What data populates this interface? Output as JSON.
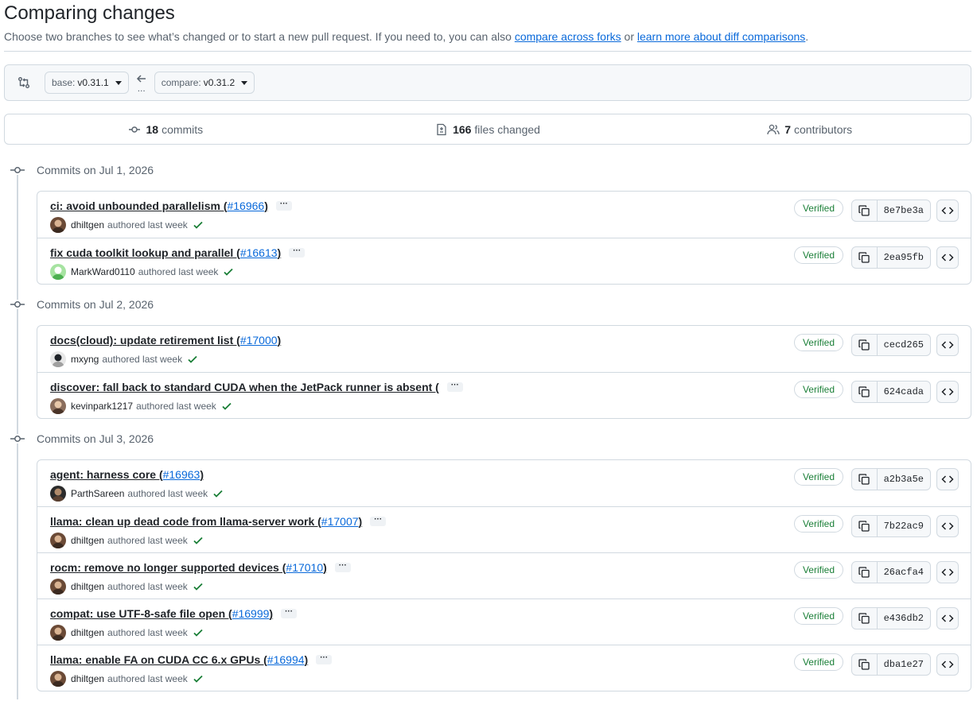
{
  "header": {
    "title": "Comparing changes",
    "subtitle_text": "Choose two branches to see what’s changed or to start a new pull request. If you need to, you can also",
    "link_forks": "compare across forks",
    "or_text": "or",
    "link_learn": "learn more about diff comparisons",
    "period": "."
  },
  "range": {
    "base_label": "base:",
    "base_value": "v0.31.1",
    "compare_label": "compare:",
    "compare_value": "v0.31.2",
    "arrow_dots": "..."
  },
  "stats": {
    "commits_count": "18",
    "commits_label": "commits",
    "files_count": "166",
    "files_label": "files changed",
    "contributors_count": "7",
    "contributors_label": "contributors"
  },
  "groups": [
    {
      "heading": "Commits on Jul 1, 2026",
      "commits": [
        {
          "message": "ci: avoid unbounded parallelism (",
          "pr": "#16966",
          "close": ")",
          "author": "dhiltgen",
          "authored": "authored last week",
          "verified": "Verified",
          "sha": "8e7be3a",
          "avatar": "dhiltgen",
          "has_ellipsis": true
        },
        {
          "message": "fix cuda toolkit lookup and parallel (",
          "pr": "#16613",
          "close": ")",
          "author": "MarkWard0110",
          "authored": "authored last week",
          "verified": "Verified",
          "sha": "2ea95fb",
          "avatar": "markward",
          "has_ellipsis": true
        }
      ]
    },
    {
      "heading": "Commits on Jul 2, 2026",
      "commits": [
        {
          "message": "docs(cloud): update retirement list (",
          "pr": "#17000",
          "close": ")",
          "author": "mxyng",
          "authored": "authored last week",
          "verified": "Verified",
          "sha": "cecd265",
          "avatar": "mxyng",
          "has_ellipsis": false
        },
        {
          "message": "discover: fall back to standard CUDA when the JetPack runner is absent (",
          "pr": "",
          "close": "",
          "author": "kevinpark1217",
          "authored": "authored last week",
          "verified": "Verified",
          "sha": "624cada",
          "avatar": "kevin",
          "has_ellipsis": true
        }
      ]
    },
    {
      "heading": "Commits on Jul 3, 2026",
      "commits": [
        {
          "message": "agent: harness core (",
          "pr": "#16963",
          "close": ")",
          "author": "ParthSareen",
          "authored": "authored last week",
          "verified": "Verified",
          "sha": "a2b3a5e",
          "avatar": "parth",
          "has_ellipsis": false
        },
        {
          "message": "llama: clean up dead code from llama-server work (",
          "pr": "#17007",
          "close": ")",
          "author": "dhiltgen",
          "authored": "authored last week",
          "verified": "Verified",
          "sha": "7b22ac9",
          "avatar": "dhiltgen",
          "has_ellipsis": true
        },
        {
          "message": "rocm: remove no longer supported devices (",
          "pr": "#17010",
          "close": ")",
          "author": "dhiltgen",
          "authored": "authored last week",
          "verified": "Verified",
          "sha": "26acfa4",
          "avatar": "dhiltgen",
          "has_ellipsis": true
        },
        {
          "message": "compat: use UTF-8-safe file open (",
          "pr": "#16999",
          "close": ")",
          "author": "dhiltgen",
          "authored": "authored last week",
          "verified": "Verified",
          "sha": "e436db2",
          "avatar": "dhiltgen",
          "has_ellipsis": true
        },
        {
          "message": "llama: enable FA on CUDA CC 6.x GPUs (",
          "pr": "#16994",
          "close": ")",
          "author": "dhiltgen",
          "authored": "authored last week",
          "verified": "Verified",
          "sha": "dba1e27",
          "avatar": "dhiltgen",
          "has_ellipsis": true
        }
      ]
    }
  ],
  "ellipsis_text": "···",
  "colors": {
    "link": "#0969da",
    "verified": "#1a7f37",
    "border": "#d1d9e0",
    "muted": "#59636e"
  },
  "icons": [
    "git-compare-icon",
    "arrow-left-icon",
    "commit-icon",
    "file-diff-icon",
    "people-icon",
    "check-icon",
    "copy-icon",
    "code-icon"
  ]
}
